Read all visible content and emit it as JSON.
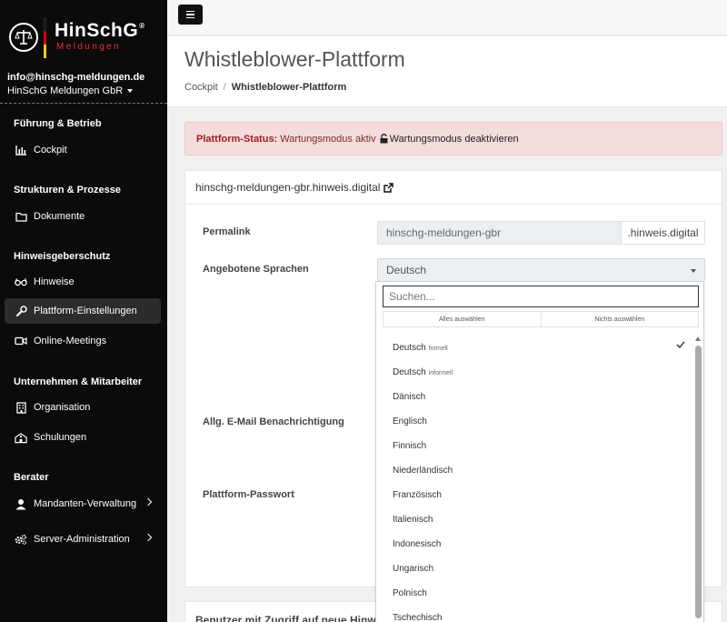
{
  "brand": {
    "name": "HinSchG",
    "reg": "®",
    "sub": "Meldungen",
    "colors": [
      "#000000",
      "#dd0000",
      "#ffcc00"
    ]
  },
  "account": {
    "email": "info@hinschg-meldungen.de",
    "org": "HinSchG Meldungen GbR"
  },
  "sidebar": {
    "sections": [
      {
        "title": "Führung & Betrieb",
        "items": [
          {
            "label": "Cockpit",
            "icon": "chart-bar-icon"
          }
        ]
      },
      {
        "title": "Strukturen & Prozesse",
        "items": [
          {
            "label": "Dokumente",
            "icon": "folder-icon"
          }
        ]
      },
      {
        "title": "Hinweisgeberschutz",
        "items": [
          {
            "label": "Hinweise",
            "icon": "glasses-icon"
          },
          {
            "label": "Plattform-Einstellungen",
            "icon": "wrench-icon",
            "active": true
          },
          {
            "label": "Online-Meetings",
            "icon": "video-icon"
          }
        ]
      },
      {
        "title": "Unternehmen & Mitarbeiter",
        "items": [
          {
            "label": "Organisation",
            "icon": "building-icon"
          },
          {
            "label": "Schulungen",
            "icon": "school-icon"
          }
        ]
      },
      {
        "title": "Berater",
        "items": [
          {
            "label": "Mandanten-Verwaltung",
            "icon": "user-icon"
          },
          {
            "label": "Server-Administration",
            "icon": "cogs-icon"
          }
        ]
      }
    ]
  },
  "header": {
    "title": "Whistleblower-Plattform",
    "breadcrumb": [
      "Cockpit",
      "Whistleblower-Plattform"
    ],
    "separator": "/"
  },
  "alert": {
    "label": "Plattform-Status:",
    "status": "Wartungsmodus aktiv",
    "action": "Wartungsmodus deaktivieren"
  },
  "card": {
    "domain": "hinschg-meldungen-gbr.hinweis.digital",
    "fields": {
      "permalink_label": "Permalink",
      "permalink_value": "hinschg-meldungen-gbr",
      "permalink_suffix": ".hinweis.digital",
      "languages_label": "Angebotene Sprachen",
      "languages_value": "Deutsch",
      "email_label": "Allg. E-Mail Benachrichtigung",
      "password_label": "Plattform-Passwort"
    }
  },
  "card2": {
    "title": "Benutzer mit Zugriff auf neue Hinweise"
  },
  "dropdown": {
    "search_placeholder": "Suchen...",
    "select_all": "Alles auswählen",
    "select_none": "Nichts auswählen",
    "options": [
      {
        "label": "Deutsch",
        "note": "formell",
        "selected": true
      },
      {
        "label": "Deutsch",
        "note": "informell"
      },
      {
        "label": "Dänisch"
      },
      {
        "label": "Englisch"
      },
      {
        "label": "Finnisch"
      },
      {
        "label": "Niederländisch"
      },
      {
        "label": "Französisch"
      },
      {
        "label": "Italienisch"
      },
      {
        "label": "Indonesisch"
      },
      {
        "label": "Ungarisch"
      },
      {
        "label": "Polnisch"
      },
      {
        "label": "Tschechisch"
      }
    ]
  }
}
